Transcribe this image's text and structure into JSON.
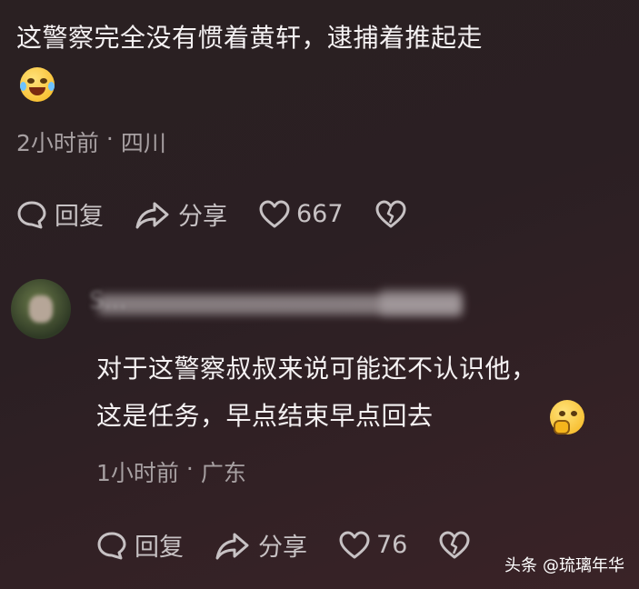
{
  "comment1": {
    "line1": "这警察完全没有惯着黄轩，逮捕着推起走",
    "emoji": "crying-laughing-emoji",
    "time": "2小时前",
    "separator": "·",
    "location": "四川",
    "reply_label": "回复",
    "share_label": "分享",
    "likes": "667"
  },
  "comment2": {
    "username": "S...",
    "line1": "对于这警察叔叔来说可能还不认识他，",
    "line2": "这是任务，早点结束早点回去",
    "emoji": "thinking-emoji",
    "time": "1小时前",
    "separator": "·",
    "location": "广东",
    "reply_label": "回复",
    "share_label": "分享",
    "likes": "76"
  },
  "watermark": {
    "brand": "头条",
    "author": "@琉璃年华"
  }
}
